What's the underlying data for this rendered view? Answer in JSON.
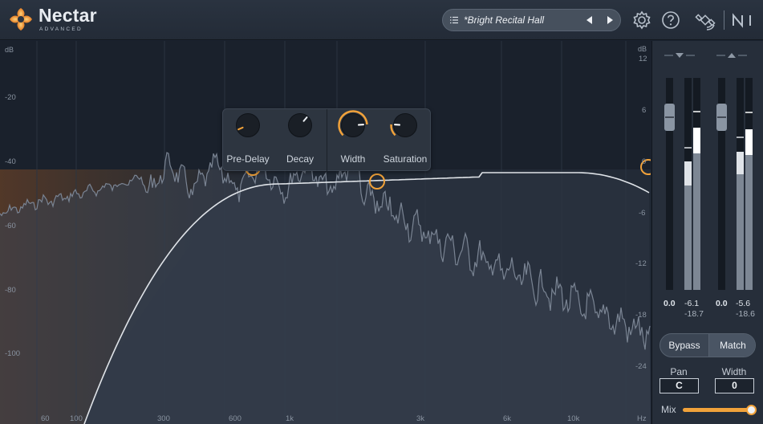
{
  "app": {
    "name": "Nectar",
    "edition": "ADVANCED"
  },
  "header": {
    "preset_name": "*Bright Recital Hall",
    "icons": [
      "preset-list-icon",
      "previous-preset-icon",
      "next-preset-icon",
      "settings-icon",
      "help-icon",
      "satellite-icon",
      "ni-logo-icon"
    ]
  },
  "spectrum": {
    "left_axis_unit": "dB",
    "left_axis_ticks": [
      "-20",
      "-40",
      "-60",
      "-80",
      "-100"
    ],
    "right_axis_unit": "dB",
    "right_axis_ticks": [
      "12",
      "6",
      "0",
      "-6",
      "-12",
      "-18",
      "-24"
    ],
    "freq_unit": "Hz",
    "freq_ticks": [
      "60",
      "100",
      "300",
      "600",
      "1k",
      "3k",
      "6k",
      "10k"
    ]
  },
  "controls": {
    "knobs": [
      {
        "label": "Pre-Delay",
        "value": 0.08,
        "active": false
      },
      {
        "label": "Decay",
        "value": 0.65,
        "active": false
      },
      {
        "label": "Width",
        "value": 0.82,
        "active": true
      },
      {
        "label": "Saturation",
        "value": 0.18,
        "active": true
      }
    ]
  },
  "meters": {
    "input": {
      "fader": "0.0",
      "peak": "-6.1",
      "rms": "-18.7"
    },
    "output": {
      "fader": "0.0",
      "peak": "-5.6",
      "rms": "-18.6"
    },
    "bypass_label": "Bypass",
    "match_label": "Match",
    "pan_label": "Pan",
    "pan_value": "C",
    "width_label": "Width",
    "width_value": "0",
    "mix_label": "Mix",
    "mix_value": 0.95
  },
  "colors": {
    "accent": "#f1a23a",
    "background": "#1d2531",
    "panel": "#262e3a"
  }
}
